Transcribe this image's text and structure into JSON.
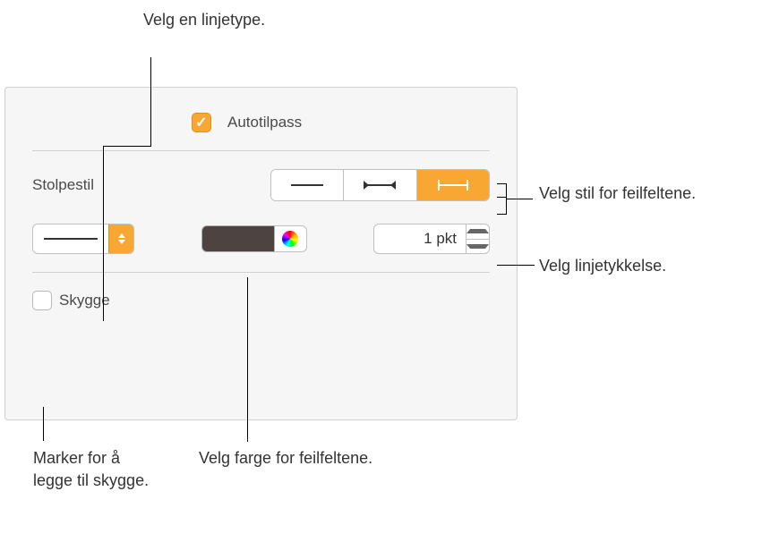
{
  "autofit": {
    "label": "Autotilpass",
    "checked": true
  },
  "stolpestil": {
    "label": "Stolpestil",
    "segments": [
      "line",
      "bar-capped",
      "bracket"
    ],
    "selected": 2
  },
  "linetype": {
    "selected": "solid"
  },
  "color": {
    "hex": "#4d4442"
  },
  "thickness": {
    "value": "1 pkt"
  },
  "shadow": {
    "label": "Skygge",
    "checked": false
  },
  "callouts": {
    "linetype": "Velg en linjetype.",
    "stolpestil": "Velg stil for feilfeltene.",
    "thickness": "Velg linjetykkelse.",
    "color": "Velg farge for feilfeltene.",
    "shadow": "Marker for å legge til skygge."
  }
}
